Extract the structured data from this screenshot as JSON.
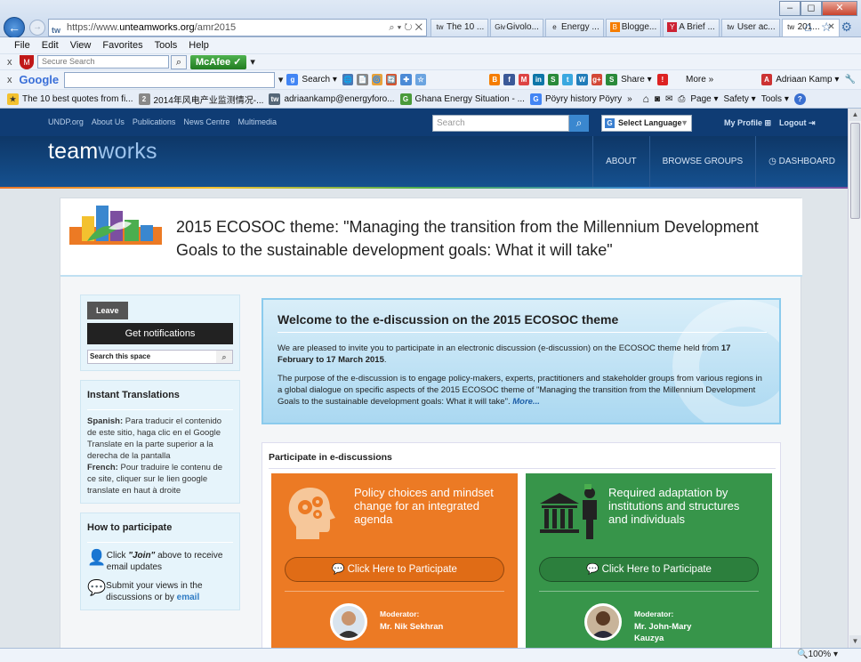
{
  "browser": {
    "url_prefix": "https://www.",
    "url_domain": "unteamworks.org",
    "url_path": "/amr2015",
    "addr_favicon": "tw",
    "address_tools": "⌕ ▾ ↻ ✕",
    "back_icon": "←",
    "forward_icon": "→",
    "win_controls": {
      "minimize": "–",
      "maximize": "◻",
      "close": "✕"
    },
    "right_icons": {
      "home": "⌂",
      "favorites": "☆",
      "settings": "⚙"
    },
    "tabs": [
      {
        "icon": "tw",
        "label": "The 10 ..."
      },
      {
        "icon": "Giv",
        "label": "Givolo..."
      },
      {
        "icon": "e",
        "label": "Energy ..."
      },
      {
        "icon": "B",
        "label": "Blogge..."
      },
      {
        "icon": "Y",
        "label": "A Brief ..."
      },
      {
        "icon": "tw",
        "label": "User ac..."
      },
      {
        "icon": "tw",
        "label": "201...",
        "close": "✕"
      }
    ],
    "menu": [
      "File",
      "Edit",
      "View",
      "Favorites",
      "Tools",
      "Help"
    ],
    "toolbar1": {
      "close": "x",
      "secure_search_placeholder": "Secure Search",
      "search_icon": "⌕",
      "mcafee": "McAfee",
      "mcafee_status": "✓",
      "dropdown": "▾"
    },
    "toolbar2": {
      "close": "x",
      "google": "Google",
      "dropdown": "▾",
      "search": "Search",
      "share": "Share",
      "more": "More",
      "more_icon": "»",
      "user": "Adriaan Kamp",
      "wrench_icon": "🔧",
      "icons": [
        "🌐",
        "📄",
        "🌀",
        "🔄",
        "✚",
        "☆"
      ],
      "share_icons": [
        "B",
        "f",
        "M",
        "in",
        "S",
        "t",
        "W",
        "g+",
        "S"
      ]
    },
    "favorites": [
      {
        "icon": "★",
        "label": "The 10 best quotes from fi..."
      },
      {
        "icon": "2",
        "label": "2014年风电产业监测情况-..."
      },
      {
        "icon": "tw",
        "label": "adriaankamp@energyforo..."
      },
      {
        "icon": "G",
        "label": "Ghana Energy Situation - ..."
      },
      {
        "icon": "G",
        "label": "Pöyry history  Pöyry"
      }
    ],
    "fav_more": "»",
    "command_bar": {
      "home": "⌂",
      "rss": "◙",
      "mail": "✉",
      "print": "⎙",
      "page": "Page",
      "safety": "Safety",
      "tools": "Tools",
      "help": "?"
    },
    "zoom": "🔍100%",
    "zoom_dropdown": "▾",
    "scroll_up": "▲",
    "scroll_down": "▼"
  },
  "site": {
    "top_links": [
      "UNDP.org",
      "About Us",
      "Publications",
      "News Centre",
      "Multimedia"
    ],
    "search_placeholder": "Search",
    "search_icon": "⌕",
    "language_icon": "G",
    "language": "Select Language",
    "language_dropdown": "▼",
    "my_profile": "My Profile ⊞",
    "logout": "Logout ⇥",
    "logo_a": "team",
    "logo_b": "works",
    "nav": [
      "ABOUT",
      "BROWSE GROUPS",
      "◷ DASHBOARD"
    ]
  },
  "page": {
    "title": "2015 ECOSOC theme: \"Managing the transition from the Millennium Development Goals to the sustainable development goals: What it will take\"",
    "leave": "Leave",
    "get_notifications": "Get notifications",
    "search_space": "Search this space",
    "search_space_icon": "⌕",
    "instant_translations": "Instant Translations",
    "spanish_label": "Spanish:",
    "spanish_text": "Para traducir el contenido de este sitio, haga clic en el Google Translate en la parte superior a la derecha de la pantalla",
    "french_label": "French:",
    "french_text": "Pour traduire le contenu de ce site, cliquer sur le lien google translate en haut à droite",
    "how_to": "How to participate",
    "how_items": [
      {
        "icon": "👤",
        "pre": "Click ",
        "em": "\"Join\"",
        "post": " above to receive email updates"
      },
      {
        "icon": "💬",
        "pre": "Submit your views in the discussions or by ",
        "link": "email"
      }
    ],
    "welcome_title": "Welcome to the e-discussion on the 2015 ECOSOC theme",
    "welcome_p1_pre": "We are pleased to invite you to participate in an electronic discussion (e-discussion) on the ECOSOC theme held from ",
    "welcome_p1_bold": "17 February to 17 March 2015",
    "welcome_p1_post": ".",
    "welcome_p2": "The purpose of the e-discussion is to engage policy-makers, experts, practitioners and stakeholder groups from various regions in a global dialogue on specific aspects of the 2015 ECOSOC theme of \"Managing the transition from the Millennium Development Goals to the sustainable development goals: What it will take\".",
    "welcome_more": "More...",
    "participate_heading": "Participate in e-discussions",
    "cards": [
      {
        "title": "Policy choices and mindset change for an integrated agenda",
        "button": "Click Here to Participate",
        "button_icon": "💬",
        "moderator_label": "Moderator:",
        "moderator": "Mr. Nik Sekhran"
      },
      {
        "title": "Required adaptation by institutions and structures and individuals",
        "button": "Click Here to Participate",
        "button_icon": "💬",
        "moderator_label": "Moderator:",
        "moderator": "Mr. John-Mary Kauzya"
      }
    ]
  }
}
